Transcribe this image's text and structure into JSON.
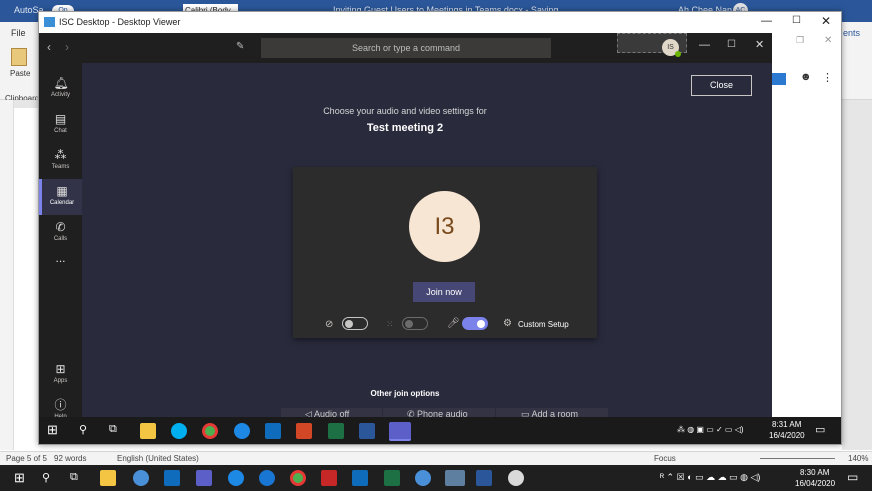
{
  "word": {
    "autosave": "AutoSa",
    "autosave_toggle": "On",
    "font_box": "Calibri (Body",
    "doc_title": "Inviting Guest Users to Meetings in Teams.docx - Saving...",
    "user_name": "Ah Chee Nan",
    "user_initials": "AC",
    "menu_file": "File",
    "paste_label": "Paste",
    "clipboard_label": "Clipboard",
    "comments_label": "ents",
    "status": {
      "page": "Page 5 of 5",
      "words": "92 words",
      "language": "English (United States)",
      "focus": "Focus",
      "zoom": "140%"
    }
  },
  "viewer": {
    "title": "ISC Desktop - Desktop Viewer"
  },
  "teams": {
    "search_placeholder": "Search or type a command",
    "profile_initials": "IS",
    "rail": [
      {
        "label": "Activity"
      },
      {
        "label": "Chat"
      },
      {
        "label": "Teams"
      },
      {
        "label": "Calendar"
      },
      {
        "label": "Calls"
      },
      {
        "label": "..."
      },
      {
        "label": "Apps"
      },
      {
        "label": "Help"
      }
    ],
    "close_btn": "Close",
    "subtitle": "Choose your audio and video settings for",
    "meeting_name": "Test meeting 2",
    "avatar_initials": "I3",
    "join_btn": "Join now",
    "custom_setup": "Custom Setup",
    "other_options_heading": "Other join options",
    "other_options": [
      "Audio off",
      "Phone audio",
      "Add a room"
    ],
    "video_on": false,
    "blur_on": false,
    "mic_on": true
  },
  "inner_taskbar": {
    "time": "8:31 AM",
    "date": "16/4/2020"
  },
  "outer_taskbar": {
    "time": "8:30 AM",
    "date": "16/04/2020"
  },
  "colors": {
    "word_blue": "#2b579a",
    "teams_bg": "#292b3d",
    "teams_rail": "#201f1f",
    "teams_accent": "#7b83eb",
    "join_btn": "#464775",
    "avatar_bg": "#f6e6d3",
    "avatar_text": "#7a4a1d"
  }
}
